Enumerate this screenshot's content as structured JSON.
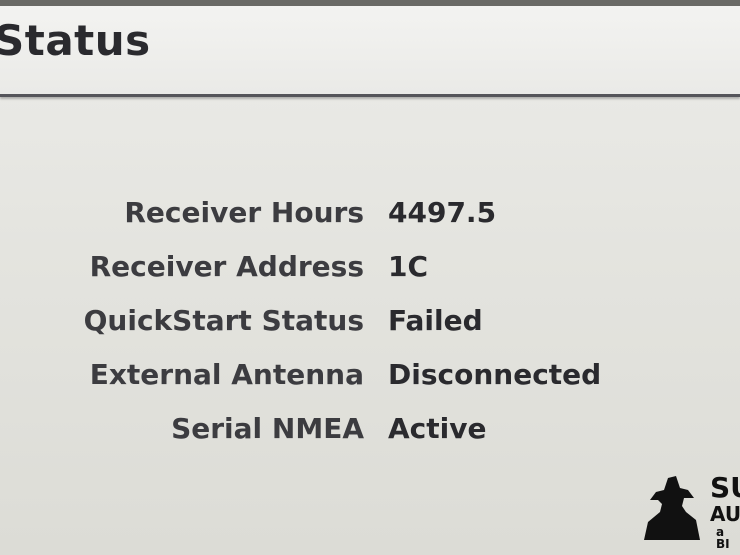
{
  "header": {
    "title": "Status"
  },
  "status": {
    "rows": [
      {
        "label": "Receiver Hours",
        "value": "4497.5"
      },
      {
        "label": "Receiver Address",
        "value": "1C"
      },
      {
        "label": "QuickStart Status",
        "value": "Failed"
      },
      {
        "label": "External Antenna",
        "value": "Disconnected"
      },
      {
        "label": "Serial NMEA",
        "value": "Active"
      }
    ]
  },
  "watermark": {
    "line1": "SU",
    "line2": "AUC",
    "line3": "a BI"
  }
}
